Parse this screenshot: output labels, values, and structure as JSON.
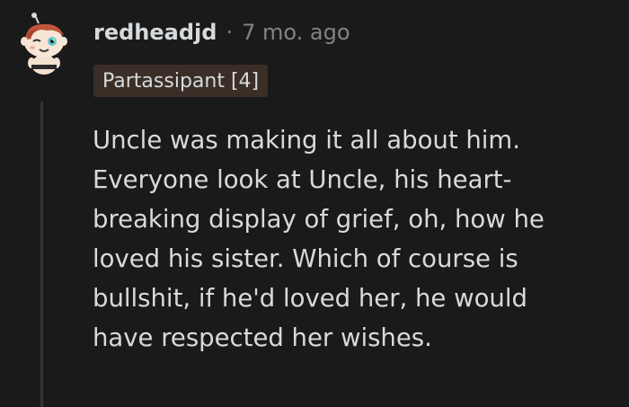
{
  "comment": {
    "username": "redheadjd",
    "separator": "·",
    "timestamp": "7 mo. ago",
    "flair": "Partassipant [4]",
    "body_lines": [
      "Uncle was making it all about him.",
      "Everyone look at Uncle, his heart-",
      "breaking display of grief, oh, how he",
      "loved his sister. Which of course is",
      "bullshit, if he'd loved her, he would",
      "have respected her wishes."
    ],
    "avatar_icon": "snoo-avatar-icon"
  },
  "colors": {
    "background": "#1a1a1b",
    "text": "#d7dadc",
    "muted": "#818384",
    "flair_bg": "#3a2e26",
    "thread_line": "#343536"
  }
}
